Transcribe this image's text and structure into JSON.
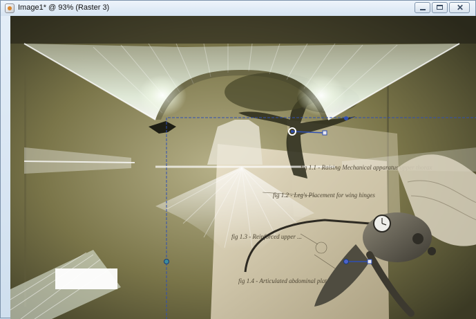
{
  "window": {
    "title": "Image1* @  93% (Raster 3)",
    "icon": "app-document-icon",
    "controls": {
      "minimize": "minimize-icon",
      "maximize": "maximize-icon",
      "close": "close-icon"
    }
  },
  "artwork": {
    "annotations": {
      "fig1": "fig 1.1 - Raising Mechanical apparatus upper thorax",
      "fig2": "fig 1.2 - Leg's Placement for wing hinges",
      "fig3": "fig 1.3 - Reinforced upper ...",
      "fig4": "fig 1.4 - Articulated abdominal plate"
    },
    "colors": {
      "base": "#6f6a45",
      "paper": "#e6dcc4",
      "guide": "#2f4fb3",
      "glow": "#f4fff2"
    }
  }
}
